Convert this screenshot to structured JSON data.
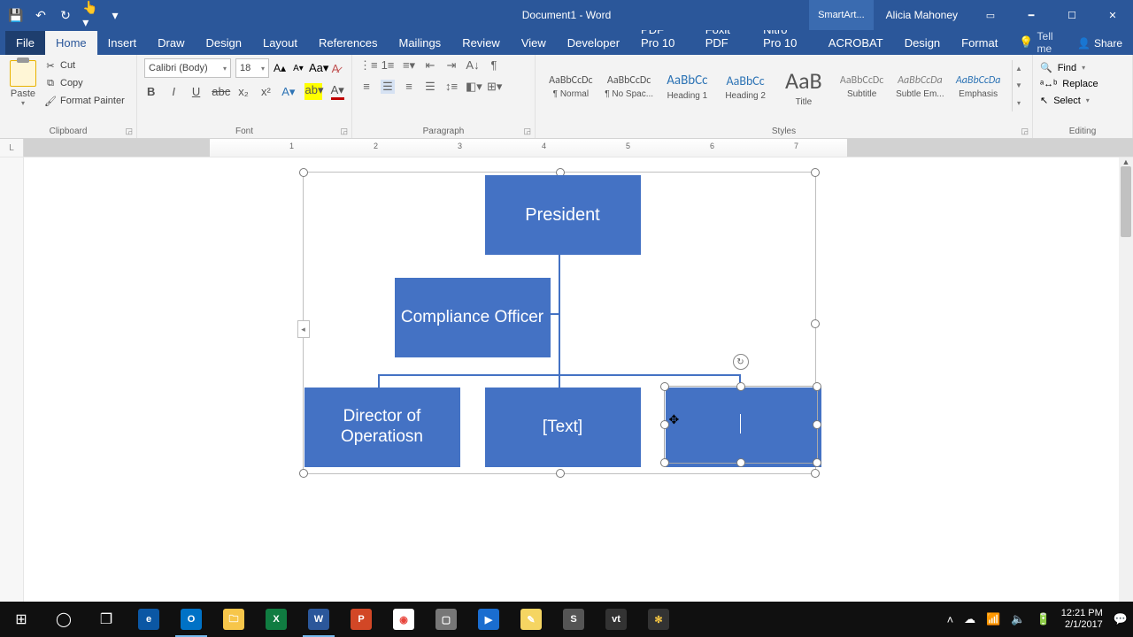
{
  "titlebar": {
    "title": "Document1 - Word",
    "smartart_label": "SmartArt...",
    "user": "Alicia Mahoney"
  },
  "tabs": {
    "file": "File",
    "list": [
      "Home",
      "Insert",
      "Draw",
      "Design",
      "Layout",
      "References",
      "Mailings",
      "Review",
      "View",
      "Developer",
      "PDF Pro 10",
      "Foxit PDF",
      "Nitro Pro 10",
      "ACROBAT",
      "Design",
      "Format"
    ],
    "active_index": 0,
    "tell_me": "Tell me",
    "share": "Share"
  },
  "ribbon": {
    "clipboard": {
      "paste": "Paste",
      "cut": "Cut",
      "copy": "Copy",
      "format_painter": "Format Painter",
      "label": "Clipboard"
    },
    "font": {
      "name": "Calibri (Body)",
      "size": "18",
      "label": "Font"
    },
    "paragraph": {
      "label": "Paragraph"
    },
    "styles": {
      "label": "Styles",
      "items": [
        {
          "preview": "AaBbCcDc",
          "name": "¶ Normal",
          "size": "12"
        },
        {
          "preview": "AaBbCcDc",
          "name": "¶ No Spac...",
          "size": "12"
        },
        {
          "preview": "AaBbCc",
          "name": "Heading 1",
          "size": "15",
          "color": "#2e74b5"
        },
        {
          "preview": "AaBbCc",
          "name": "Heading 2",
          "size": "14",
          "color": "#2e74b5"
        },
        {
          "preview": "AaB",
          "name": "Title",
          "size": "26"
        },
        {
          "preview": "AaBbCcDc",
          "name": "Subtitle",
          "size": "12",
          "color": "#808080"
        },
        {
          "preview": "AaBbCcDa",
          "name": "Subtle Em...",
          "size": "12",
          "italic": true,
          "color": "#808080"
        },
        {
          "preview": "AaBbCcDa",
          "name": "Emphasis",
          "size": "12",
          "italic": true,
          "color": "#2e74b5"
        }
      ]
    },
    "editing": {
      "find": "Find",
      "replace": "Replace",
      "select": "Select",
      "label": "Editing"
    }
  },
  "ruler_numbers": [
    "1",
    "2",
    "3",
    "4",
    "5",
    "6",
    "7"
  ],
  "chart_data": {
    "type": "org-chart",
    "nodes": [
      {
        "id": "president",
        "label": "President",
        "level": 0
      },
      {
        "id": "compliance",
        "label": "Compliance Officer",
        "level": 1,
        "assistant": true
      },
      {
        "id": "dir_ops",
        "label": "Director of Operatiosn",
        "level": 2
      },
      {
        "id": "text_ph",
        "label": "[Text]",
        "level": 2
      },
      {
        "id": "empty",
        "label": "",
        "level": 2,
        "selected": true
      }
    ],
    "edges": [
      [
        "president",
        "compliance"
      ],
      [
        "president",
        "dir_ops"
      ],
      [
        "president",
        "text_ph"
      ],
      [
        "president",
        "empty"
      ]
    ]
  },
  "taskbar": {
    "time": "12:21 PM",
    "date": "2/1/2017"
  }
}
